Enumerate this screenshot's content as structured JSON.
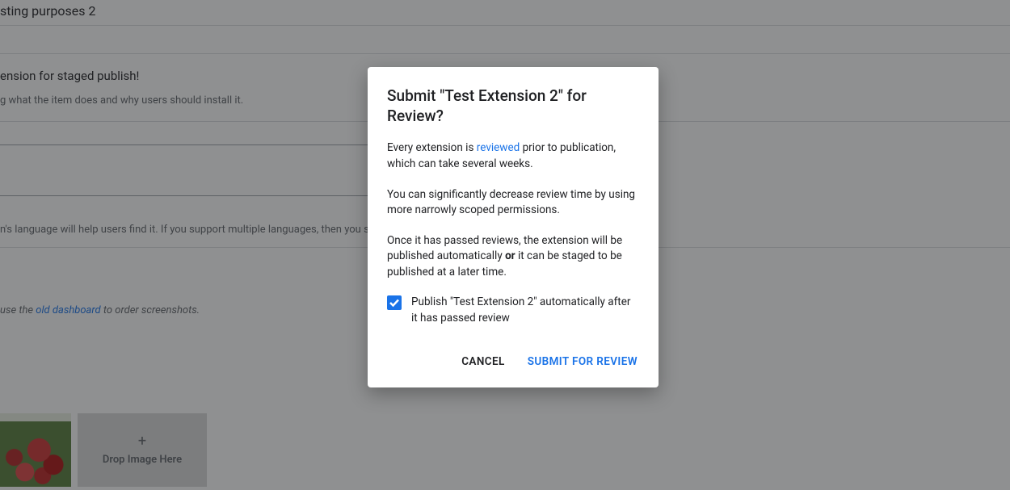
{
  "background": {
    "title_fragment": "sting purposes 2",
    "subtitle": "ension for staged publish!",
    "helper": "g what the item does and why users should install it.",
    "lang_hint": "n's language will help users find it. If you support multiple languages, then you sh",
    "order_prefix": "use the ",
    "order_link": "old dashboard",
    "order_suffix": " to order screenshots.",
    "drop_label": "Drop Image Here"
  },
  "dialog": {
    "title": "Submit \"Test Extension 2\" for Review?",
    "p1_a": "Every extension is ",
    "p1_link": "reviewed",
    "p1_b": " prior to publication, which can take several weeks.",
    "p2": "You can significantly decrease review time by using more narrowly scoped permissions.",
    "p3_a": "Once it has passed reviews, the extension will be published automatically ",
    "p3_bold": "or",
    "p3_b": " it can be staged to be published at a later time.",
    "checkbox_checked": true,
    "checkbox_label": "Publish \"Test Extension 2\" automatically after it has passed review",
    "cancel": "Cancel",
    "submit": "Submit for Review"
  }
}
